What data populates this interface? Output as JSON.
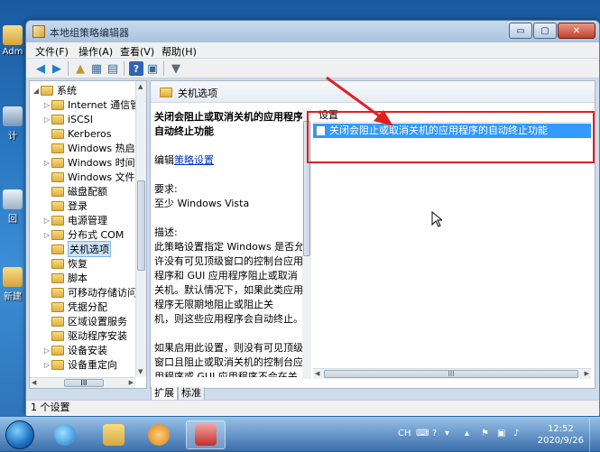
{
  "desktop": {
    "icons": [
      {
        "label": "Adm"
      },
      {
        "label": "计"
      },
      {
        "label": "回"
      },
      {
        "label": "新建"
      }
    ]
  },
  "window": {
    "title": "本地组策略编辑器",
    "caption": {
      "minimize": "▭",
      "maximize": "▢",
      "close": "✕"
    }
  },
  "menu": {
    "items": [
      "文件(F)",
      "操作(A)",
      "查看(V)",
      "帮助(H)"
    ]
  },
  "tree": {
    "items": [
      {
        "label": "系统",
        "expander": "◢",
        "level": 0
      },
      {
        "label": "Internet 通信管",
        "expander": "▷",
        "level": 1
      },
      {
        "label": "iSCSI",
        "expander": "▷",
        "level": 1
      },
      {
        "label": "Kerberos",
        "expander": "",
        "level": 1
      },
      {
        "label": "Windows 热启",
        "expander": "",
        "level": 1
      },
      {
        "label": "Windows 时间",
        "expander": "▷",
        "level": 1
      },
      {
        "label": "Windows 文件",
        "expander": "",
        "level": 1
      },
      {
        "label": "磁盘配额",
        "expander": "",
        "level": 1
      },
      {
        "label": "登录",
        "expander": "",
        "level": 1
      },
      {
        "label": "电源管理",
        "expander": "▷",
        "level": 1
      },
      {
        "label": "分布式 COM",
        "expander": "▷",
        "level": 1
      },
      {
        "label": "关机选项",
        "expander": "",
        "level": 1,
        "selected": true
      },
      {
        "label": "恢复",
        "expander": "",
        "level": 1
      },
      {
        "label": "脚本",
        "expander": "",
        "level": 1
      },
      {
        "label": "可移动存储访问",
        "expander": "",
        "level": 1
      },
      {
        "label": "凭据分配",
        "expander": "",
        "level": 1
      },
      {
        "label": "区域设置服务",
        "expander": "",
        "level": 1
      },
      {
        "label": "驱动程序安装",
        "expander": "",
        "level": 1
      },
      {
        "label": "设备安装",
        "expander": "▷",
        "level": 1
      },
      {
        "label": "设备重定向",
        "expander": "▷",
        "level": 1
      }
    ],
    "hscroll_grip": "III"
  },
  "content": {
    "header": "关机选项",
    "description": {
      "title_lines": [
        "关闭会阻止或取消关机的应用程序的",
        "自动终止功能"
      ],
      "edit_prefix": "编辑",
      "edit_link": "策略设置",
      "requirements_label": "要求:",
      "requirements_value": "至少 Windows Vista",
      "desc_label": "描述:",
      "desc_lines": [
        "此策略设置指定 Windows 是否允",
        "许没有可见顶级窗口的控制台应用",
        "程序和 GUI 应用程序阻止或取消",
        "关机。默认情况下，如果此类应用",
        "程序无限期地阻止或阻止关",
        "机，则这些应用程序会自动终止。",
        "",
        "如果启用此设置，则没有可见顶级",
        "窗口且阻止或取消关机的控制台应",
        "用程序或 GUI 应用程序不会在关"
      ]
    },
    "list": {
      "header": "设置",
      "rows": [
        "关闭会阻止或取消关机的应用程序的自动终止功能"
      ],
      "hscroll_grip": "III"
    },
    "tabs": [
      "扩展",
      "标准"
    ]
  },
  "status": {
    "text": "1 个设置"
  },
  "taskbar": {
    "tray": {
      "lang": "CH"
    },
    "clock": {
      "time": "12:52",
      "date": "2020/9/26"
    }
  },
  "colors": {
    "selection": "#3399ff",
    "annotation": "#e02020",
    "link": "#0033cc"
  }
}
